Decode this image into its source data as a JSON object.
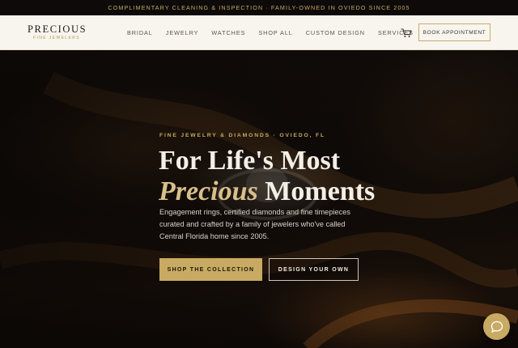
{
  "announcement": "COMPLIMENTARY CLEANING & INSPECTION · FAMILY-OWNED IN OVIEDO SINCE 2005",
  "brand": {
    "name": "PRECIOUS",
    "tagline": "FINE JEWELERS"
  },
  "nav": {
    "items": [
      "BRIDAL",
      "JEWELRY",
      "WATCHES",
      "SHOP ALL",
      "CUSTOM DESIGN",
      "SERVICES"
    ],
    "cta": "BOOK APPOINTMENT"
  },
  "hero": {
    "eyebrow": "FINE JEWELRY & DIAMONDS · OVIEDO, FL",
    "title_line1": "For Life's Most",
    "title_em": "Precious",
    "title_line2_rest": " Moments",
    "description": "Engagement rings, certified diamonds and fine timepieces curated and crafted by a family of jewelers who've called Central Florida home since 2005.",
    "primary_cta": "SHOP THE COLLECTION",
    "secondary_cta": "DESIGN YOUR OWN"
  },
  "icons": {
    "cart": "shopping-cart-icon",
    "chat": "chat-bubble-icon"
  },
  "colors": {
    "accent": "#c8aa62",
    "nav_bg": "#f8f5ee",
    "dark": "#0d0a09"
  }
}
